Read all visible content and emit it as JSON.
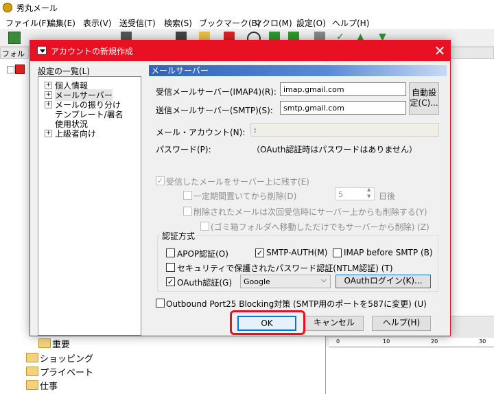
{
  "app": {
    "title": "秀丸メール",
    "menu": [
      "ファイル(F)",
      "編集(E)",
      "表示(V)",
      "送受信(T)",
      "検索(S)",
      "ブックマーク(B)",
      "マクロ(M)",
      "設定(O)",
      "ヘルプ(H)"
    ],
    "folder_header": "フォルダ",
    "folders": [
      "重要",
      "ショッピング",
      "プライベート",
      "仕事"
    ],
    "ruler": [
      "0",
      "10",
      "20",
      "30"
    ]
  },
  "dialog": {
    "title": "アカウントの新規作成",
    "close_glyph": "✕",
    "tree_label": "設定の一覧(L)",
    "tree_items": [
      "個人情報",
      "メールサーバー",
      "メールの振り分け",
      "テンプレート/署名",
      "使用状況",
      "上級者向け"
    ],
    "section_title": "メールサーバー",
    "imap_label": "受信メールサーバー(IMAP4)(R):",
    "imap_value": "imap.gmail.com",
    "smtp_label": "送信メールサーバー(SMTP)(S):",
    "smtp_value": "smtp.gmail.com",
    "auto_button": "自動設定(C)...",
    "account_label": "メール・アカウント(N):",
    "account_value": ":",
    "password_label": "パスワード(P):",
    "password_note": "（OAuth認証時はパスワードはありません）",
    "leave_on_server": "受信したメールをサーバー上に残す(E)",
    "delete_after": "一定期間置いてから削除(D)",
    "days_value": "5",
    "days_unit": "日後",
    "delete_on_next": "削除されたメールは次回受信時にサーバー上からも削除する(Y)",
    "trash_note": "(ゴミ箱フォルダへ移動しただけでもサーバーから削除) (Z)",
    "auth_legend": "認証方式",
    "apop": "APOP認証(O)",
    "smtp_auth": "SMTP-AUTH(M)",
    "imap_before_smtp": "IMAP before SMTP (B)",
    "ntlm": "セキュリティで保護されたパスワード認証(NTLM認証) (T)",
    "oauth": "OAuth認証(G)",
    "oauth_provider": "Google",
    "oauth_login": "OAuthログイン(K)...",
    "outbound_port": "Outbound Port25 Blocking対策 (SMTP用のポートを587に変更) (U)",
    "ok": "OK",
    "cancel": "キャンセル",
    "help": "ヘルプ(H)"
  },
  "checkbox_states": {
    "leave_on_server": true,
    "delete_after": false,
    "delete_on_next": false,
    "trash_note": false,
    "apop": false,
    "smtp_auth": true,
    "imap_before_smtp": false,
    "ntlm": false,
    "oauth": true,
    "outbound_port": false
  },
  "colors": {
    "dialog_accent": "#e81123",
    "section_bar": "#2f63b7",
    "ok_highlight": "#e81123"
  }
}
